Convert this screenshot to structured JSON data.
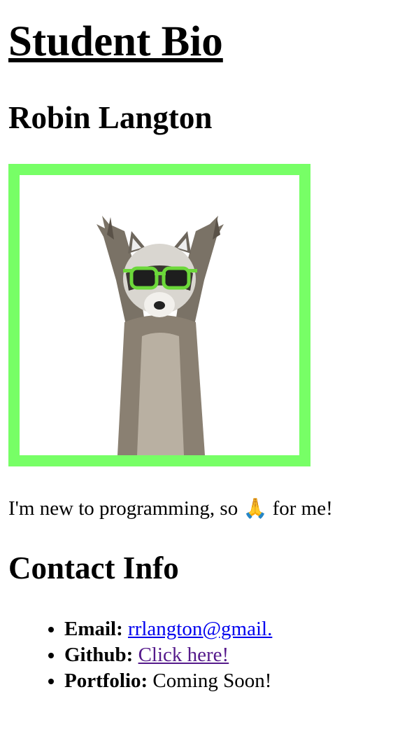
{
  "page": {
    "title": "Student Bio",
    "name": "Robin Langton"
  },
  "photo": {
    "subject": "raccoon-with-green-sunglasses",
    "frame_color": "#77ff66"
  },
  "bio": {
    "text_before": "I'm new to programming, so",
    "emoji": "🙏",
    "text_after": "for me!"
  },
  "contact": {
    "heading": "Contact Info",
    "items": [
      {
        "label": "Email:",
        "value": "rrlangton@gmail.",
        "link": true,
        "color": "#0000ee"
      },
      {
        "label": "Github:",
        "value": "Click here!",
        "link": true,
        "color": "#551a8b"
      },
      {
        "label": "Portfolio:",
        "value": "Coming Soon!",
        "link": false
      }
    ]
  }
}
